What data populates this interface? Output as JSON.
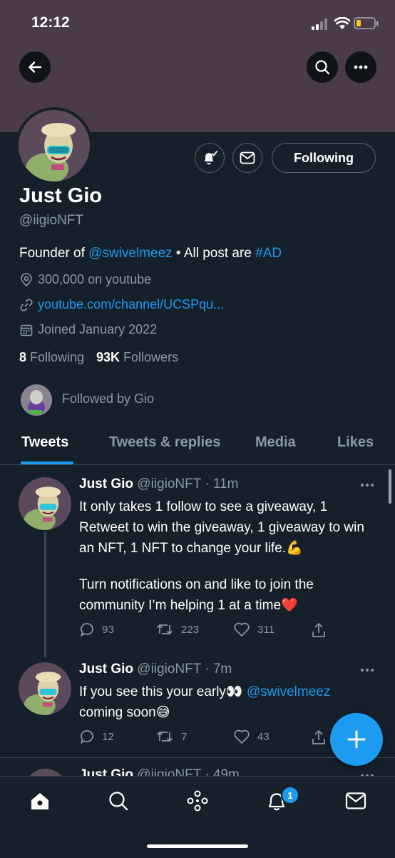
{
  "status": {
    "time": "12:12"
  },
  "profile": {
    "name": "Just Gio",
    "handle": "@iigioNFT",
    "bio_prefix": "Founder of ",
    "bio_mention": "@swivelmeez",
    "bio_middle": " • All post are ",
    "bio_hashtag": "#AD",
    "location": "300,000 on youtube",
    "website": "youtube.com/channel/UCSPqu...",
    "joined": "Joined January 2022",
    "following_count": "8",
    "following_label": "Following",
    "followers_count": "93K",
    "followers_label": "Followers",
    "followed_by": "Followed by Gio",
    "follow_button": "Following"
  },
  "tabs": [
    "Tweets",
    "Tweets & replies",
    "Media",
    "Likes"
  ],
  "tweets": [
    {
      "name": "Just Gio",
      "meta": "@iigioNFT · 11m",
      "text1": "It only takes 1 follow to see a giveaway, 1 Retweet to win the giveaway, 1 giveaway to win an NFT, 1 NFT to change your life.💪",
      "text2": "Turn notifications on and like to join the community I’m helping 1 at a time❤️",
      "replies": "93",
      "retweets": "223",
      "likes": "311"
    },
    {
      "name": "Just Gio",
      "meta": "@iigioNFT · 7m",
      "text_prefix": "If you see this your early👀 ",
      "mention": "@swivelmeez",
      "text_suffix": " coming soon😅",
      "replies": "12",
      "retweets": "7",
      "likes": "43"
    },
    {
      "name": "Just Gio",
      "meta": "@iigioNFT · 49m"
    }
  ],
  "nav": {
    "notification_badge": "1"
  },
  "colors": {
    "background": "#15202b",
    "accent": "#1d9bf0",
    "banner": "#4a3a4c"
  }
}
